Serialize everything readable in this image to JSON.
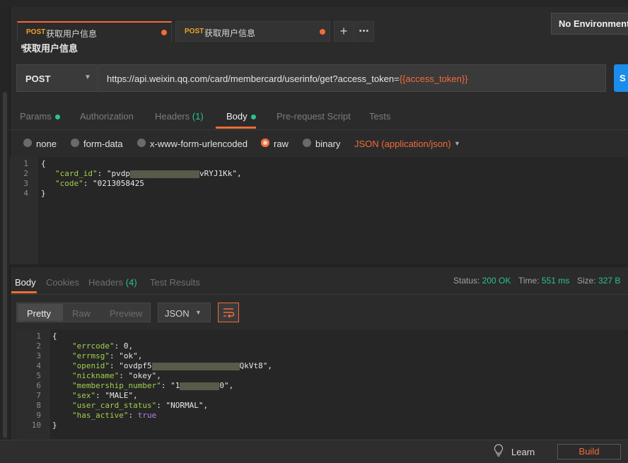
{
  "tabs": [
    {
      "method": "POST",
      "title": "获取用户信息",
      "active": true
    },
    {
      "method": "POST",
      "title": "获取用户信息",
      "active": false
    }
  ],
  "tab_actions": {
    "add": "+",
    "more": "•••"
  },
  "environment": {
    "label": "No Environment"
  },
  "request": {
    "name": "获取用户信息",
    "method": "POST",
    "url_prefix": "https://api.weixin.qq.com/card/membercard/userinfo/get?access_token=",
    "url_var": "{{access_token}}",
    "send_label": "S"
  },
  "request_tabs": {
    "params": "Params",
    "authorization": "Authorization",
    "headers": "Headers",
    "headers_count": "(1)",
    "body": "Body",
    "prerequest": "Pre-request Script",
    "tests": "Tests"
  },
  "body_types": {
    "none": "none",
    "form_data": "form-data",
    "urlencoded": "x-www-form-urlencoded",
    "raw": "raw",
    "binary": "binary",
    "selected": "raw",
    "content_type": "JSON (application/json)"
  },
  "request_body": {
    "line_numbers": [
      "1",
      "2",
      "3",
      "4"
    ],
    "open": "{",
    "card_id_key": "\"card_id\"",
    "card_id_start": "\"pvdp",
    "card_id_end": "vRYJ1Kk\"",
    "code_key": "\"code\"",
    "code_value": "\"0213058425",
    "close": "}"
  },
  "response_tabs": {
    "body": "Body",
    "cookies": "Cookies",
    "headers": "Headers",
    "headers_count": "(4)",
    "test_results": "Test Results"
  },
  "response_meta": {
    "status_label": "Status:",
    "status": "200 OK",
    "time_label": "Time:",
    "time": "551 ms",
    "size_label": "Size:",
    "size": "327 B"
  },
  "response_view": {
    "pretty": "Pretty",
    "raw": "Raw",
    "preview": "Preview",
    "language": "JSON"
  },
  "response_body": {
    "line_numbers": [
      "1",
      "2",
      "3",
      "4",
      "5",
      "6",
      "7",
      "8",
      "9",
      "10"
    ],
    "open": "{",
    "errcode_key": "\"errcode\"",
    "errcode_val": "0",
    "errmsg_key": "\"errmsg\"",
    "errmsg_val": "\"ok\"",
    "openid_key": "\"openid\"",
    "openid_start": "\"ovdpf5",
    "openid_end": "QkVt8\"",
    "nickname_key": "\"nickname\"",
    "nickname_val": "\"okey\"",
    "membership_key": "\"membership_number\"",
    "membership_start": "\"1",
    "membership_end": "0\"",
    "sex_key": "\"sex\"",
    "sex_val": "\"MALE\"",
    "status_key": "\"user_card_status\"",
    "status_val": "\"NORMAL\"",
    "active_key": "\"has_active\"",
    "active_val": "true",
    "close": "}"
  },
  "footer": {
    "learn": "Learn",
    "build": "Build"
  },
  "colors": {
    "accent": "#f26b3a",
    "success": "#2cc28a",
    "key": "#9fd04c",
    "send": "#1a8dec"
  }
}
